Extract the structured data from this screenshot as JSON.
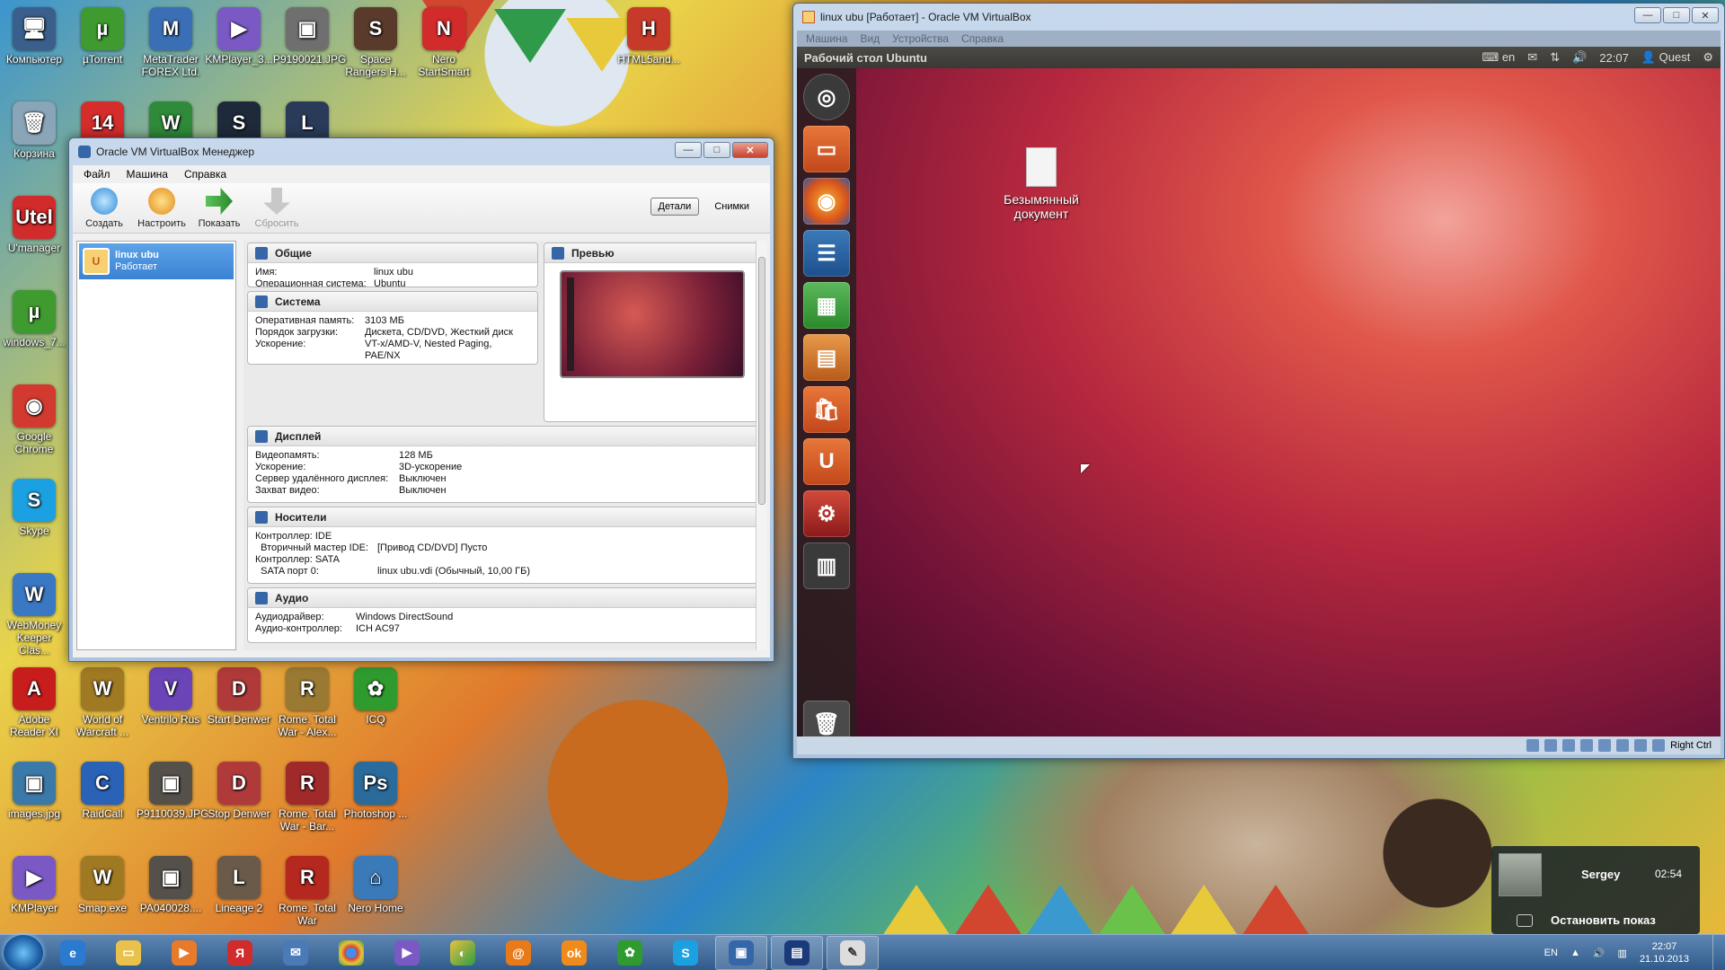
{
  "desktop": {
    "icons": [
      {
        "label": "Компьютер",
        "glyph": "🖥",
        "color": "#3a5f8c"
      },
      {
        "label": "µTorrent",
        "glyph": "µ",
        "color": "#3f9b2f"
      },
      {
        "label": "MetaTrader FOREX Ltd.",
        "glyph": "M",
        "color": "#3b6fb5"
      },
      {
        "label": "KMPlayer_3...",
        "glyph": "▶",
        "color": "#7a59c4"
      },
      {
        "label": "P9190021.JPG",
        "glyph": "▣",
        "color": "#6f6f6f"
      },
      {
        "label": "Space Rangers H...",
        "glyph": "S",
        "color": "#5a3a2a"
      },
      {
        "label": "Nero StartSmart",
        "glyph": "N",
        "color": "#d22b2b"
      },
      {
        "label": "HTML5and...",
        "glyph": "H",
        "color": "#c73a2a"
      },
      {
        "label": "Корзина",
        "glyph": "🗑",
        "color": "#8aa4b8"
      },
      {
        "label": "",
        "glyph": "14",
        "color": "#d52c2c"
      },
      {
        "label": "",
        "glyph": "W",
        "color": "#2f8a3a"
      },
      {
        "label": "",
        "glyph": "S",
        "color": "#1e2a3a"
      },
      {
        "label": "",
        "glyph": "L",
        "color": "#2a3b5a"
      },
      {
        "label": "U'manager",
        "glyph": "Utel",
        "color": "#d12b2b"
      },
      {
        "label": "windows_7...",
        "glyph": "µ",
        "color": "#3f9b2f"
      },
      {
        "label": "Google Chrome",
        "glyph": "◉",
        "color": "#d33a2f"
      },
      {
        "label": "Skype",
        "glyph": "S",
        "color": "#1ba1e2"
      },
      {
        "label": "WebMoney Keeper Clas...",
        "glyph": "W",
        "color": "#3a78c4"
      },
      {
        "label": "Adobe Reader XI",
        "glyph": "A",
        "color": "#c81d1d"
      },
      {
        "label": "World of Warcraft ...",
        "glyph": "W",
        "color": "#a07a23"
      },
      {
        "label": "Ventrilo Rus",
        "glyph": "V",
        "color": "#6b45b8"
      },
      {
        "label": "Start Denwer",
        "glyph": "D",
        "color": "#b03a3a"
      },
      {
        "label": "Rome. Total War - Alex...",
        "glyph": "R",
        "color": "#9a7a33"
      },
      {
        "label": "ICQ",
        "glyph": "✿",
        "color": "#2f9b2f"
      },
      {
        "label": "images.jpg",
        "glyph": "▣",
        "color": "#3a79a8"
      },
      {
        "label": "RaidCall",
        "glyph": "C",
        "color": "#2a62b8"
      },
      {
        "label": "P9110039.JPG",
        "glyph": "▣",
        "color": "#55504a"
      },
      {
        "label": "Stop Denwer",
        "glyph": "D",
        "color": "#b03a3a"
      },
      {
        "label": "Rome. Total War - Bar...",
        "glyph": "R",
        "color": "#a02a2a"
      },
      {
        "label": "Photoshop ...",
        "glyph": "Ps",
        "color": "#2a6b9b"
      },
      {
        "label": "KMPlayer",
        "glyph": "▶",
        "color": "#7a59c4"
      },
      {
        "label": "Smap.exe",
        "glyph": "W",
        "color": "#a07a23"
      },
      {
        "label": "PA040028....",
        "glyph": "▣",
        "color": "#55504a"
      },
      {
        "label": "Lineage 2",
        "glyph": "L",
        "color": "#6a5a4a"
      },
      {
        "label": "Rome. Total War",
        "glyph": "R",
        "color": "#b5281f"
      },
      {
        "label": "Nero Home",
        "glyph": "⌂",
        "color": "#3a7ab8"
      }
    ]
  },
  "manager": {
    "title": "Oracle VM VirtualBox Менеджер",
    "menu": [
      "Файл",
      "Машина",
      "Справка"
    ],
    "toolbar": {
      "create": "Создать",
      "settings": "Настроить",
      "show": "Показать",
      "discard": "Сбросить",
      "details": "Детали",
      "snapshots": "Снимки"
    },
    "vm": {
      "name": "linux ubu",
      "state": "Работает"
    },
    "sections": {
      "general": {
        "title": "Общие",
        "rows": [
          [
            "Имя:",
            "linux ubu"
          ],
          [
            "Операционная система:",
            "Ubuntu"
          ]
        ]
      },
      "system": {
        "title": "Система",
        "rows": [
          [
            "Оперативная память:",
            "3103 МБ"
          ],
          [
            "Порядок загрузки:",
            "Дискета, CD/DVD, Жесткий диск"
          ],
          [
            "Ускорение:",
            "VT-x/AMD-V, Nested Paging, PAE/NX"
          ]
        ]
      },
      "preview": {
        "title": "Превью"
      },
      "display": {
        "title": "Дисплей",
        "rows": [
          [
            "Видеопамять:",
            "128 МБ"
          ],
          [
            "Ускорение:",
            "3D-ускорение"
          ],
          [
            "Сервер удалённого дисплея:",
            "Выключен"
          ],
          [
            "Захват видео:",
            "Выключен"
          ]
        ]
      },
      "storage": {
        "title": "Носители",
        "rows": [
          [
            "Контроллер: IDE",
            ""
          ],
          [
            "  Вторичный мастер IDE:",
            "[Привод CD/DVD] Пусто"
          ],
          [
            "Контроллер: SATA",
            ""
          ],
          [
            "  SATA порт 0:",
            "linux ubu.vdi (Обычный, 10,00 ГБ)"
          ]
        ]
      },
      "audio": {
        "title": "Аудио",
        "rows": [
          [
            "Аудиодрайвер:",
            "Windows DirectSound"
          ],
          [
            "Аудио-контроллер:",
            "ICH AC97"
          ]
        ]
      }
    }
  },
  "vmwindow": {
    "title": "linux ubu [Работает] - Oracle VM VirtualBox",
    "menu": [
      "Машина",
      "Вид",
      "Устройства",
      "Справка"
    ],
    "ubuntu": {
      "panel_title": "Рабочий стол Ubuntu",
      "lang": "en",
      "time": "22:07",
      "user": "Quest",
      "file_label": "Безымянный документ"
    },
    "hostkey": "Right Ctrl"
  },
  "skype_share": {
    "name": "Sergey",
    "time": "02:54",
    "stop": "Остановить показ"
  },
  "taskbar": {
    "lang": "EN",
    "time": "22:07",
    "date": "21.10.2013"
  }
}
